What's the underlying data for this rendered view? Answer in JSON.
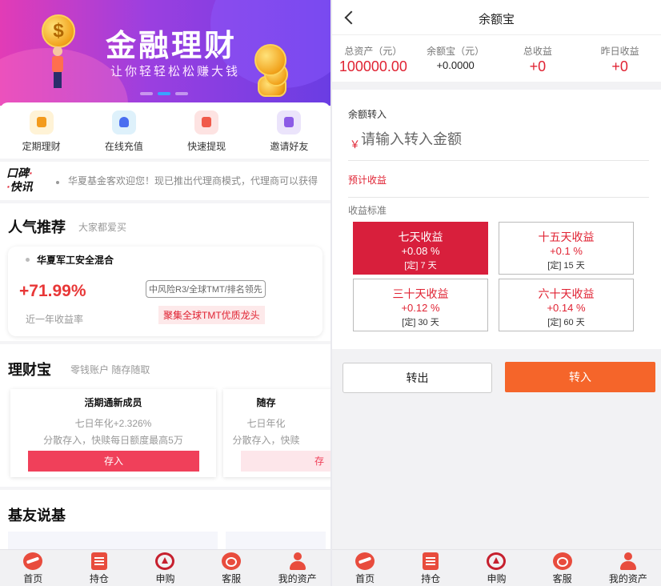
{
  "left": {
    "banner": {
      "title": "金融理财",
      "subtitle": "让你轻轻松松赚大钱",
      "coin_symbol": "$"
    },
    "quick_links": [
      {
        "label": "定期理财",
        "icon": "briefcase-icon"
      },
      {
        "label": "在线充值",
        "icon": "recharge-icon"
      },
      {
        "label": "快速提现",
        "icon": "withdraw-icon"
      },
      {
        "label": "邀请好友",
        "icon": "invite-icon"
      }
    ],
    "notice": {
      "logo_line1": "口碑",
      "logo_dot1": "·",
      "logo_dot2": "·",
      "logo_line2": "快讯",
      "text": "华夏基金客欢迎您！现已推出代理商模式，代理商可以获得"
    },
    "hot": {
      "title": "人气推荐",
      "subtitle": "大家都爱买",
      "fund_name": "华夏军工安全混合",
      "rate": "+71.99%",
      "rate_label": "近一年收益率",
      "tag": "中风险R3/全球TMT/排名领先",
      "slogan": "聚集全球TMT优质龙头"
    },
    "licaibao": {
      "title": "理财宝",
      "subtitle": "零钱账户 随存随取",
      "cards": [
        {
          "title": "活期通新成员",
          "line1": "七日年化+2.326%",
          "line2": "分散存入，快赎每日额度最高5万",
          "button": "存入"
        },
        {
          "title": "随存",
          "line1": "七日年化",
          "line2": "分散存入，快赎",
          "button": "存"
        }
      ]
    },
    "jiyou": {
      "title": "基友说基"
    }
  },
  "tabbar": [
    {
      "label": "首页",
      "icon": "home-icon"
    },
    {
      "label": "持仓",
      "icon": "holdings-icon"
    },
    {
      "label": "申购",
      "icon": "purchase-icon"
    },
    {
      "label": "客服",
      "icon": "service-icon"
    },
    {
      "label": "我的资产",
      "icon": "user-icon"
    }
  ],
  "right": {
    "header": {
      "title": "余额宝"
    },
    "stats": [
      {
        "label": "总资产（元）",
        "value": "100000.00"
      },
      {
        "label": "余额宝（元）",
        "value": "+0.0000"
      },
      {
        "label": "总收益",
        "value": "+0"
      },
      {
        "label": "昨日收益",
        "value": "+0"
      }
    ],
    "form": {
      "transfer_label": "余额转入",
      "currency": "￥",
      "amount_placeholder": "请输入转入金额",
      "amount_value": "",
      "estimate_label": "预计收益",
      "standard_label": "收益标准"
    },
    "plans": [
      {
        "name": "七天收益",
        "rate": "+0.08 %",
        "term": "[定] 7 天",
        "selected": true
      },
      {
        "name": "十五天收益",
        "rate": "+0.1 %",
        "term": "[定] 15 天",
        "selected": false
      },
      {
        "name": "三十天收益",
        "rate": "+0.12 %",
        "term": "[定] 30 天",
        "selected": false
      },
      {
        "name": "六十天收益",
        "rate": "+0.14 %",
        "term": "[定] 60 天",
        "selected": false
      }
    ],
    "buttons": {
      "out": "转出",
      "in": "转入"
    }
  },
  "colors": {
    "accent_red": "#e02333",
    "selected_plan": "#d81f3c",
    "transfer_in": "#f5652a",
    "banner_start": "#e23cb6",
    "banner_end": "#6a3de3"
  }
}
